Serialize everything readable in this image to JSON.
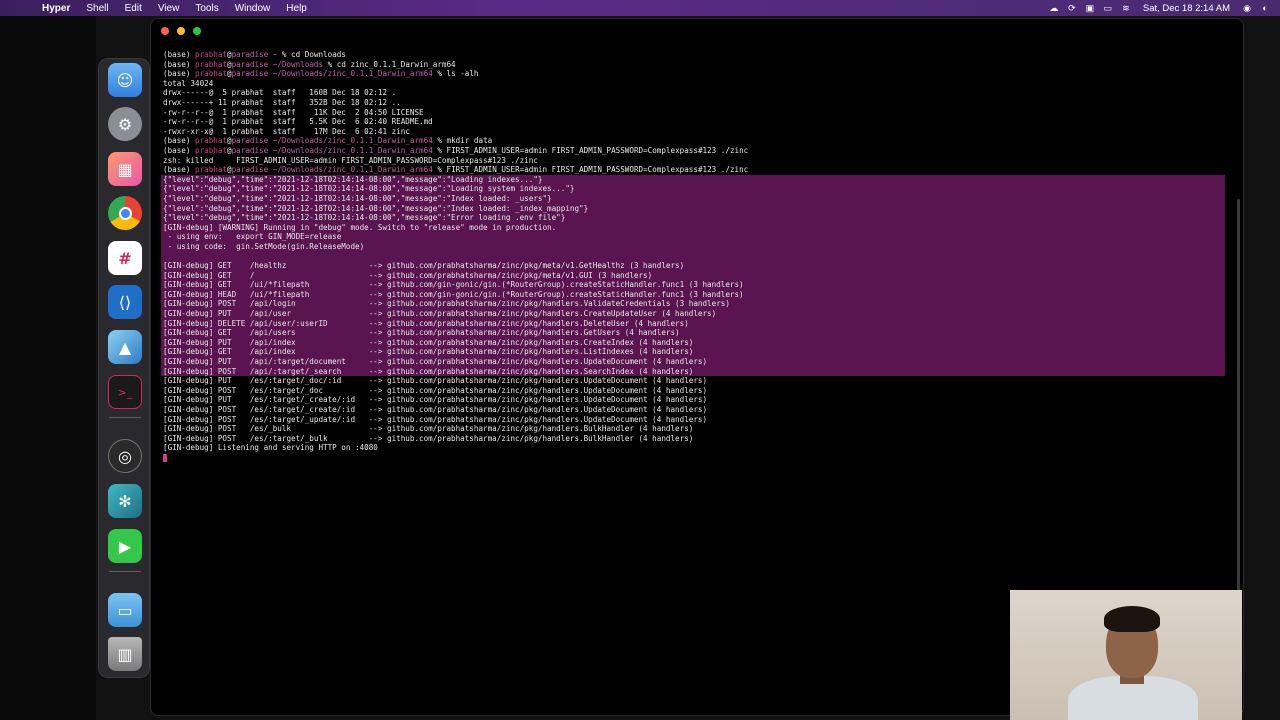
{
  "menubar": {
    "apple_icon": "apple-logo-icon",
    "app_name": "Hyper",
    "items": [
      "Shell",
      "Edit",
      "View",
      "Tools",
      "Window",
      "Help"
    ],
    "clock": "Sat, Dec 18  2:14 AM",
    "status_icons": [
      "creative-cloud-icon",
      "sync-icon",
      "screen-icon",
      "battery-icon",
      "wifi-icon",
      "siri-icon",
      "control-center-icon"
    ]
  },
  "dock": {
    "apps": [
      "finder-icon",
      "system-preferences-icon",
      "launchpad-icon",
      "chrome-icon",
      "slack-icon",
      "vscode-icon",
      "preview-icon",
      "terminal-icon",
      "obs-icon",
      "tool-icon",
      "facetime-icon",
      "folder-icon",
      "trash-icon"
    ]
  },
  "terminal": {
    "lines": [
      "(base) prabhat@paradise ~ % cd Downloads",
      "(base) prabhat@paradise ~/Downloads % cd zinc_0.1.1_Darwin_arm64",
      "(base) prabhat@paradise ~/Downloads/zinc_0.1.1_Darwin_arm64 % ls -alh",
      "total 34024",
      "drwx------@  5 prabhat  staff   160B Dec 18 02:12 .",
      "drwx------+ 11 prabhat  staff   352B Dec 18 02:12 ..",
      "-rw-r--r--@  1 prabhat  staff    11K Dec  2 04:50 LICENSE",
      "-rw-r--r--@  1 prabhat  staff   5.5K Dec  6 02:40 README.md",
      "-rwxr-xr-x@  1 prabhat  staff    17M Dec  6 02:41 zinc",
      "(base) prabhat@paradise ~/Downloads/zinc_0.1.1_Darwin_arm64 % mkdir data",
      "(base) prabhat@paradise ~/Downloads/zinc_0.1.1_Darwin_arm64 % FIRST_ADMIN_USER=admin FIRST_ADMIN_PASSWORD=Complexpass#123 ./zinc",
      "zsh: killed     FIRST_ADMIN_USER=admin FIRST_ADMIN_PASSWORD=Complexpass#123 ./zinc",
      "(base) prabhat@paradise ~/Downloads/zinc_0.1.1_Darwin_arm64 % FIRST_ADMIN_USER=admin FIRST_ADMIN_PASSWORD=Complexpass#123 ./zinc",
      "{\"level\":\"debug\",\"time\":\"2021-12-18T02:14:14-08:00\",\"message\":\"Loading indexes...\"}",
      "{\"level\":\"debug\",\"time\":\"2021-12-18T02:14:14-08:00\",\"message\":\"Loading system indexes...\"}",
      "{\"level\":\"debug\",\"time\":\"2021-12-18T02:14:14-08:00\",\"message\":\"Index loaded: _users\"}",
      "{\"level\":\"debug\",\"time\":\"2021-12-18T02:14:14-08:00\",\"message\":\"Index loaded: _index_mapping\"}",
      "{\"level\":\"debug\",\"time\":\"2021-12-18T02:14:14-08:00\",\"message\":\"Error loading .env file\"}",
      "[GIN-debug] [WARNING] Running in \"debug\" mode. Switch to \"release\" mode in production.",
      " - using env:   export GIN_MODE=release",
      " - using code:  gin.SetMode(gin.ReleaseMode)",
      "",
      "[GIN-debug] GET    /healthz                  --> github.com/prabhatsharma/zinc/pkg/meta/v1.GetHealthz (3 handlers)",
      "[GIN-debug] GET    /                         --> github.com/prabhatsharma/zinc/pkg/meta/v1.GUI (3 handlers)",
      "[GIN-debug] GET    /ui/*filepath             --> github.com/gin-gonic/gin.(*RouterGroup).createStaticHandler.func1 (3 handlers)",
      "[GIN-debug] HEAD   /ui/*filepath             --> github.com/gin-gonic/gin.(*RouterGroup).createStaticHandler.func1 (3 handlers)",
      "[GIN-debug] POST   /api/login                --> github.com/prabhatsharma/zinc/pkg/handlers.ValidateCredentials (3 handlers)",
      "[GIN-debug] PUT    /api/user                 --> github.com/prabhatsharma/zinc/pkg/handlers.CreateUpdateUser (4 handlers)",
      "[GIN-debug] DELETE /api/user/:userID         --> github.com/prabhatsharma/zinc/pkg/handlers.DeleteUser (4 handlers)",
      "[GIN-debug] GET    /api/users                --> github.com/prabhatsharma/zinc/pkg/handlers.GetUsers (4 handlers)",
      "[GIN-debug] PUT    /api/index                --> github.com/prabhatsharma/zinc/pkg/handlers.CreateIndex (4 handlers)",
      "[GIN-debug] GET    /api/index                --> github.com/prabhatsharma/zinc/pkg/handlers.ListIndexes (4 handlers)",
      "[GIN-debug] PUT    /api/:target/document     --> github.com/prabhatsharma/zinc/pkg/handlers.UpdateDocument (4 handlers)",
      "[GIN-debug] POST   /api/:target/_search      --> github.com/prabhatsharma/zinc/pkg/handlers.SearchIndex (4 handlers)",
      "[GIN-debug] PUT    /es/:target/_doc/:id      --> github.com/prabhatsharma/zinc/pkg/handlers.UpdateDocument (4 handlers)",
      "[GIN-debug] POST   /es/:target/_doc          --> github.com/prabhatsharma/zinc/pkg/handlers.UpdateDocument (4 handlers)",
      "[GIN-debug] PUT    /es/:target/_create/:id   --> github.com/prabhatsharma/zinc/pkg/handlers.UpdateDocument (4 handlers)",
      "[GIN-debug] POST   /es/:target/_create/:id   --> github.com/prabhatsharma/zinc/pkg/handlers.UpdateDocument (4 handlers)",
      "[GIN-debug] POST   /es/:target/_update/:id   --> github.com/prabhatsharma/zinc/pkg/handlers.UpdateDocument (4 handlers)",
      "[GIN-debug] POST   /es/_bulk                 --> github.com/prabhatsharma/zinc/pkg/handlers.BulkHandler (4 handlers)",
      "[GIN-debug] POST   /es/:target/_bulk         --> github.com/prabhatsharma/zinc/pkg/handlers.BulkHandler (4 handlers)",
      "[GIN-debug] Listening and serving HTTP on :4080"
    ],
    "highlight_range": [
      13,
      33
    ],
    "colors": {
      "prompt_user": "#d23c8a",
      "selection": "#5a1450",
      "text": "#e8e8e8"
    }
  }
}
